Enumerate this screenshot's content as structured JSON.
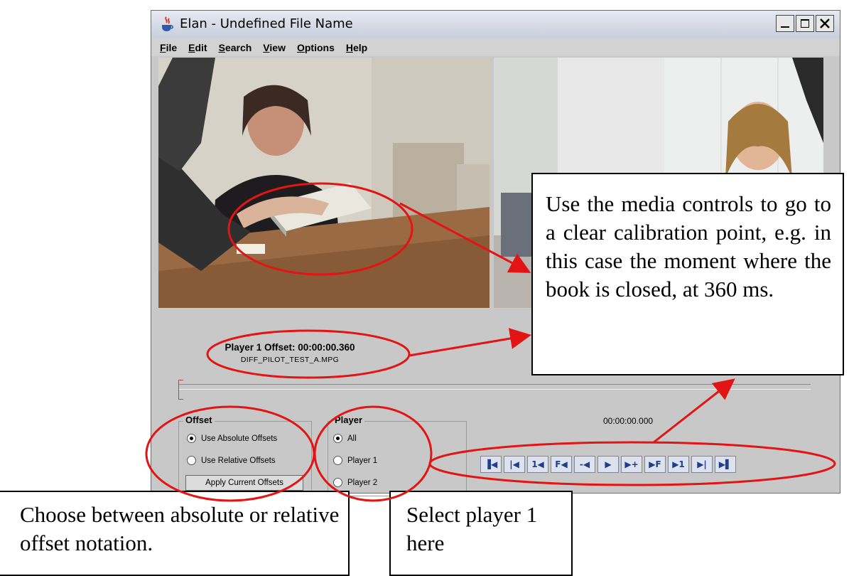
{
  "window": {
    "title": "Elan - Undefined File Name",
    "app_icon": "java-cup-icon",
    "buttons": [
      "minimize-icon",
      "maximize-icon",
      "close-icon"
    ]
  },
  "menu": {
    "items": [
      {
        "label": "File",
        "mnemonic": "F"
      },
      {
        "label": "Edit",
        "mnemonic": "E"
      },
      {
        "label": "Search",
        "mnemonic": "S"
      },
      {
        "label": "View",
        "mnemonic": "V"
      },
      {
        "label": "Options",
        "mnemonic": "O"
      },
      {
        "label": "Help",
        "mnemonic": "H"
      }
    ]
  },
  "player_info": {
    "offset_text": "Player 1 Offset: 00:00:00.360",
    "file_name": "DIFF_PILOT_TEST_A.MPG"
  },
  "offset_group": {
    "title": "Offset",
    "options": [
      {
        "label": "Use Absolute Offsets",
        "selected": true
      },
      {
        "label": "Use Relative Offsets",
        "selected": false
      }
    ],
    "apply_button": "Apply Current Offsets"
  },
  "player_group": {
    "title": "Player",
    "options": [
      {
        "label": "All",
        "selected": true
      },
      {
        "label": "Player 1",
        "selected": false
      },
      {
        "label": "Player 2",
        "selected": false
      }
    ]
  },
  "media": {
    "timecode": "00:00:00.000",
    "controls": [
      {
        "icon": "go-to-begin-icon",
        "glyph": "▐◀"
      },
      {
        "icon": "previous-frame-icon",
        "glyph": "|◀"
      },
      {
        "icon": "previous-1-frame-icon",
        "glyph": "1◀"
      },
      {
        "icon": "previous-f-icon",
        "glyph": "F◀"
      },
      {
        "icon": "previous-scroll-icon",
        "glyph": "-◀"
      },
      {
        "icon": "play-icon",
        "glyph": "▶"
      },
      {
        "icon": "next-scroll-icon",
        "glyph": "▶+"
      },
      {
        "icon": "next-f-icon",
        "glyph": "▶F"
      },
      {
        "icon": "next-1-frame-icon",
        "glyph": "▶1"
      },
      {
        "icon": "next-frame-icon",
        "glyph": "▶|"
      },
      {
        "icon": "go-to-end-icon",
        "glyph": "▶▌"
      }
    ]
  },
  "annotations": {
    "callout_media": "Use the media controls to go to a clear calibration point, e.g. in this case the moment where the book is closed, at 360 ms.",
    "callout_offset": "Choose between absolute or relative offset notation.",
    "callout_player": "Select player 1 here",
    "highlight_color": "#e31414"
  }
}
